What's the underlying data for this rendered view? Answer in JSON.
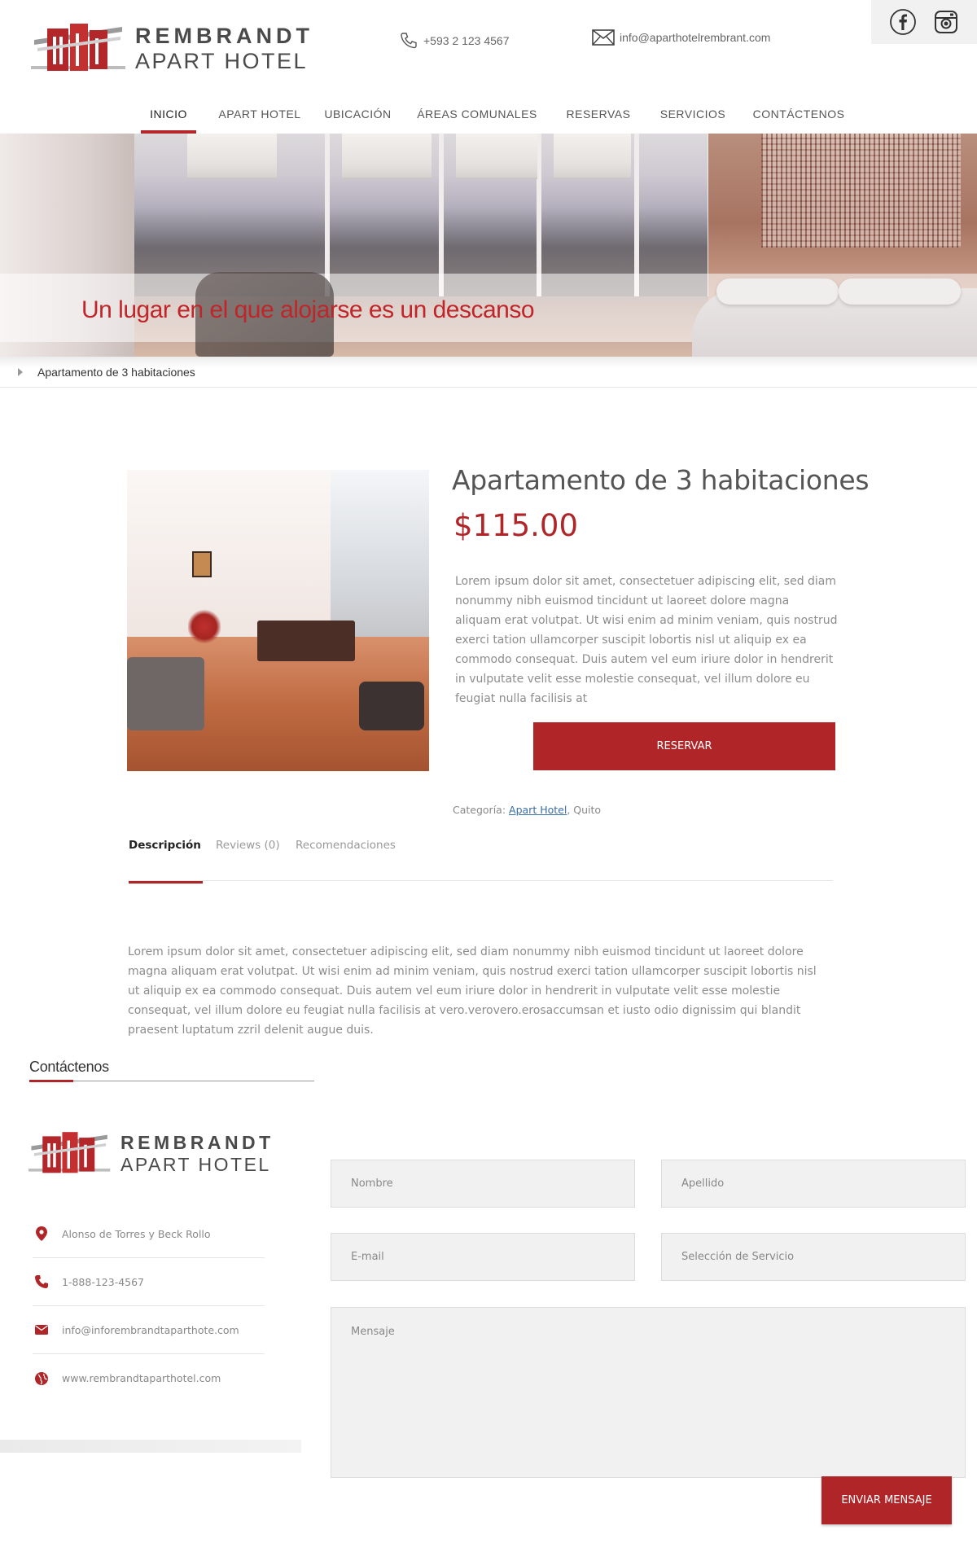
{
  "header": {
    "logo": {
      "line1": "REMBRANDT",
      "line2": "APART HOTEL"
    },
    "phone": "+593 2 123 4567",
    "email": "info@aparthotelrembrant.com",
    "social": [
      "facebook-icon",
      "instagram-icon"
    ]
  },
  "nav": {
    "items": [
      {
        "label": "INICIO",
        "active": true
      },
      {
        "label": "APART HOTEL"
      },
      {
        "label": "UBICACIÓN"
      },
      {
        "label": "ÁREAS COMUNALES"
      },
      {
        "label": "RESERVAS"
      },
      {
        "label": "SERVICIOS"
      },
      {
        "label": "CONTÁCTENOS"
      }
    ]
  },
  "hero": {
    "tagline": "Un lugar en el que alojarse es un descanso"
  },
  "breadcrumb": {
    "current": "Apartamento de 3 habitaciones"
  },
  "product": {
    "title": "Apartamento de 3 habitaciones",
    "price": "$115.00",
    "description": "Lorem ipsum dolor sit amet, consectetuer adipiscing elit, sed diam nonummy nibh euismod tincidunt ut laoreet dolore magna aliquam erat volutpat. Ut wisi enim ad minim veniam, quis nostrud exerci tation ullamcorper suscipit lobortis nisl ut aliquip ex ea commodo consequat. Duis autem vel eum iriure dolor in hendrerit in vulputate velit esse molestie consequat, vel illum dolore eu feugiat nulla facilisis at",
    "reserve_label": "RESERVAR",
    "category_label": "Categoría:",
    "category_link": "Apart Hotel",
    "category_rest": ", Quito"
  },
  "tabs": {
    "items": [
      {
        "label": "Descripción",
        "active": true
      },
      {
        "label": "Reviews (0)"
      },
      {
        "label": "Recomendaciones"
      }
    ],
    "content": "Lorem ipsum dolor sit amet, consectetuer adipiscing elit, sed diam nonummy nibh euismod tincidunt ut laoreet dolore magna aliquam erat volutpat. Ut wisi enim ad minim veniam, quis nostrud exerci tation ullamcorper suscipit lobortis nisl ut aliquip ex ea commodo consequat. Duis autem vel eum iriure dolor in hendrerit in vulputate velit esse molestie consequat, vel illum dolore eu feugiat nulla facilisis at vero.verovero.erosaccumsan et iusto odio dignissim qui blandit praesent luptatum zzril delenit augue duis."
  },
  "contact": {
    "heading": "Contáctenos",
    "logo": {
      "line1": "REMBRANDT",
      "line2": "APART HOTEL"
    },
    "info": [
      {
        "icon": "location-pin-icon",
        "text": "Alonso de Torres y Beck Rollo"
      },
      {
        "icon": "phone-icon",
        "text": "1-888-123-4567"
      },
      {
        "icon": "envelope-icon",
        "text": "info@inforembrandtaparthote.com"
      },
      {
        "icon": "globe-icon",
        "text": "www.rembrandtaparthotel.com"
      }
    ],
    "form": {
      "nombre": "Nombre",
      "apellido": "Apellido",
      "email": "E-mail",
      "servicio": "Selección de Servicio",
      "mensaje": "Mensaje",
      "send_label": "ENVIAR MENSAJE"
    }
  },
  "colors": {
    "accent": "#b02528",
    "text": "#555555",
    "muted": "#8c8c8c",
    "field_bg": "#f1f1f1"
  }
}
